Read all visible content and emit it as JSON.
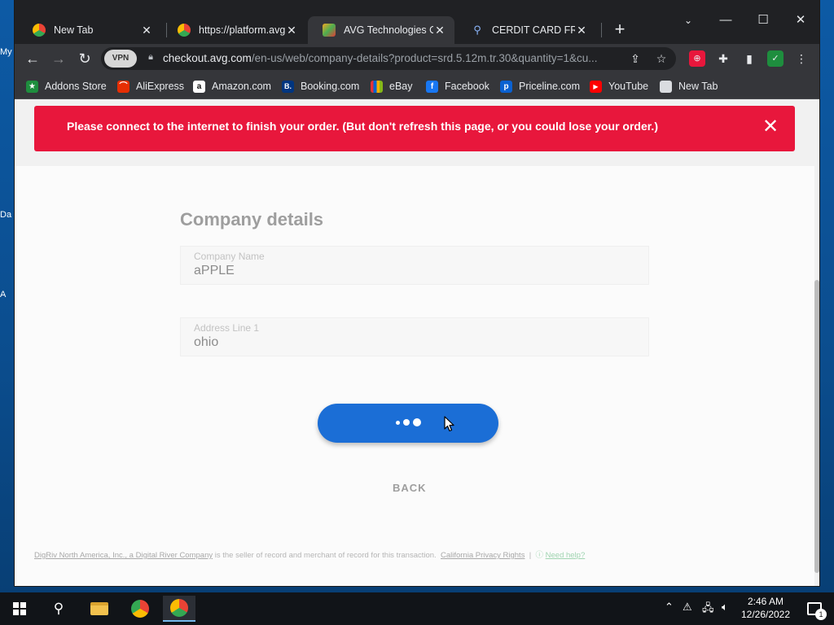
{
  "browser": {
    "tabs": [
      {
        "title": "New Tab",
        "active": false
      },
      {
        "title": "https://platform.avg.c",
        "active": false
      },
      {
        "title": "AVG Technologies Or",
        "active": true
      },
      {
        "title": "CERDIT CARD FREE -",
        "active": false
      }
    ],
    "address": {
      "vpn_label": "VPN",
      "host": "checkout.avg.com",
      "path": "/en-us/web/company-details?product=srd.5.12m.tr.30&quantity=1&cu..."
    },
    "bookmarks": [
      {
        "label": "Addons Store",
        "icon": "addons-store-icon",
        "color": "#1e8e3e",
        "glyph": "★"
      },
      {
        "label": "AliExpress",
        "icon": "aliexpress-icon",
        "color": "#e62e04",
        "glyph": "⌒"
      },
      {
        "label": "Amazon.com",
        "icon": "amazon-icon",
        "color": "#ffffff",
        "glyph": "a"
      },
      {
        "label": "Booking.com",
        "icon": "booking-icon",
        "color": "#003580",
        "glyph": "B."
      },
      {
        "label": "eBay",
        "icon": "ebay-icon",
        "color": "#333333",
        "glyph": "▬"
      },
      {
        "label": "Facebook",
        "icon": "facebook-icon",
        "color": "#1877f2",
        "glyph": "f"
      },
      {
        "label": "Priceline.com",
        "icon": "priceline-icon",
        "color": "#0a61d1",
        "glyph": "p"
      },
      {
        "label": "YouTube",
        "icon": "youtube-icon",
        "color": "#ff0000",
        "glyph": "▶"
      },
      {
        "label": "New Tab",
        "icon": "newtab-page-icon",
        "color": "#dadce0",
        "glyph": ""
      }
    ]
  },
  "page": {
    "banner": "Please connect to the internet to finish your order. (But don't refresh this page, or you could lose your order.)",
    "title": "Company details",
    "fields": [
      {
        "label": "Company Name",
        "value": "aPPLE"
      },
      {
        "label": "Address Line 1",
        "value": "ohio"
      }
    ],
    "back_label": "BACK",
    "footer": {
      "seller": "DigRiv North America, Inc., a Digital River Company",
      "text": " is the seller of record and merchant of record for this transaction.",
      "privacy": "California Privacy Rights",
      "help": "Need help?"
    }
  },
  "taskbar": {
    "time": "2:46 AM",
    "date": "12/26/2022",
    "notification_count": "1"
  },
  "colors": {
    "banner": "#e8173c",
    "primary_button": "#1b6ed6"
  }
}
